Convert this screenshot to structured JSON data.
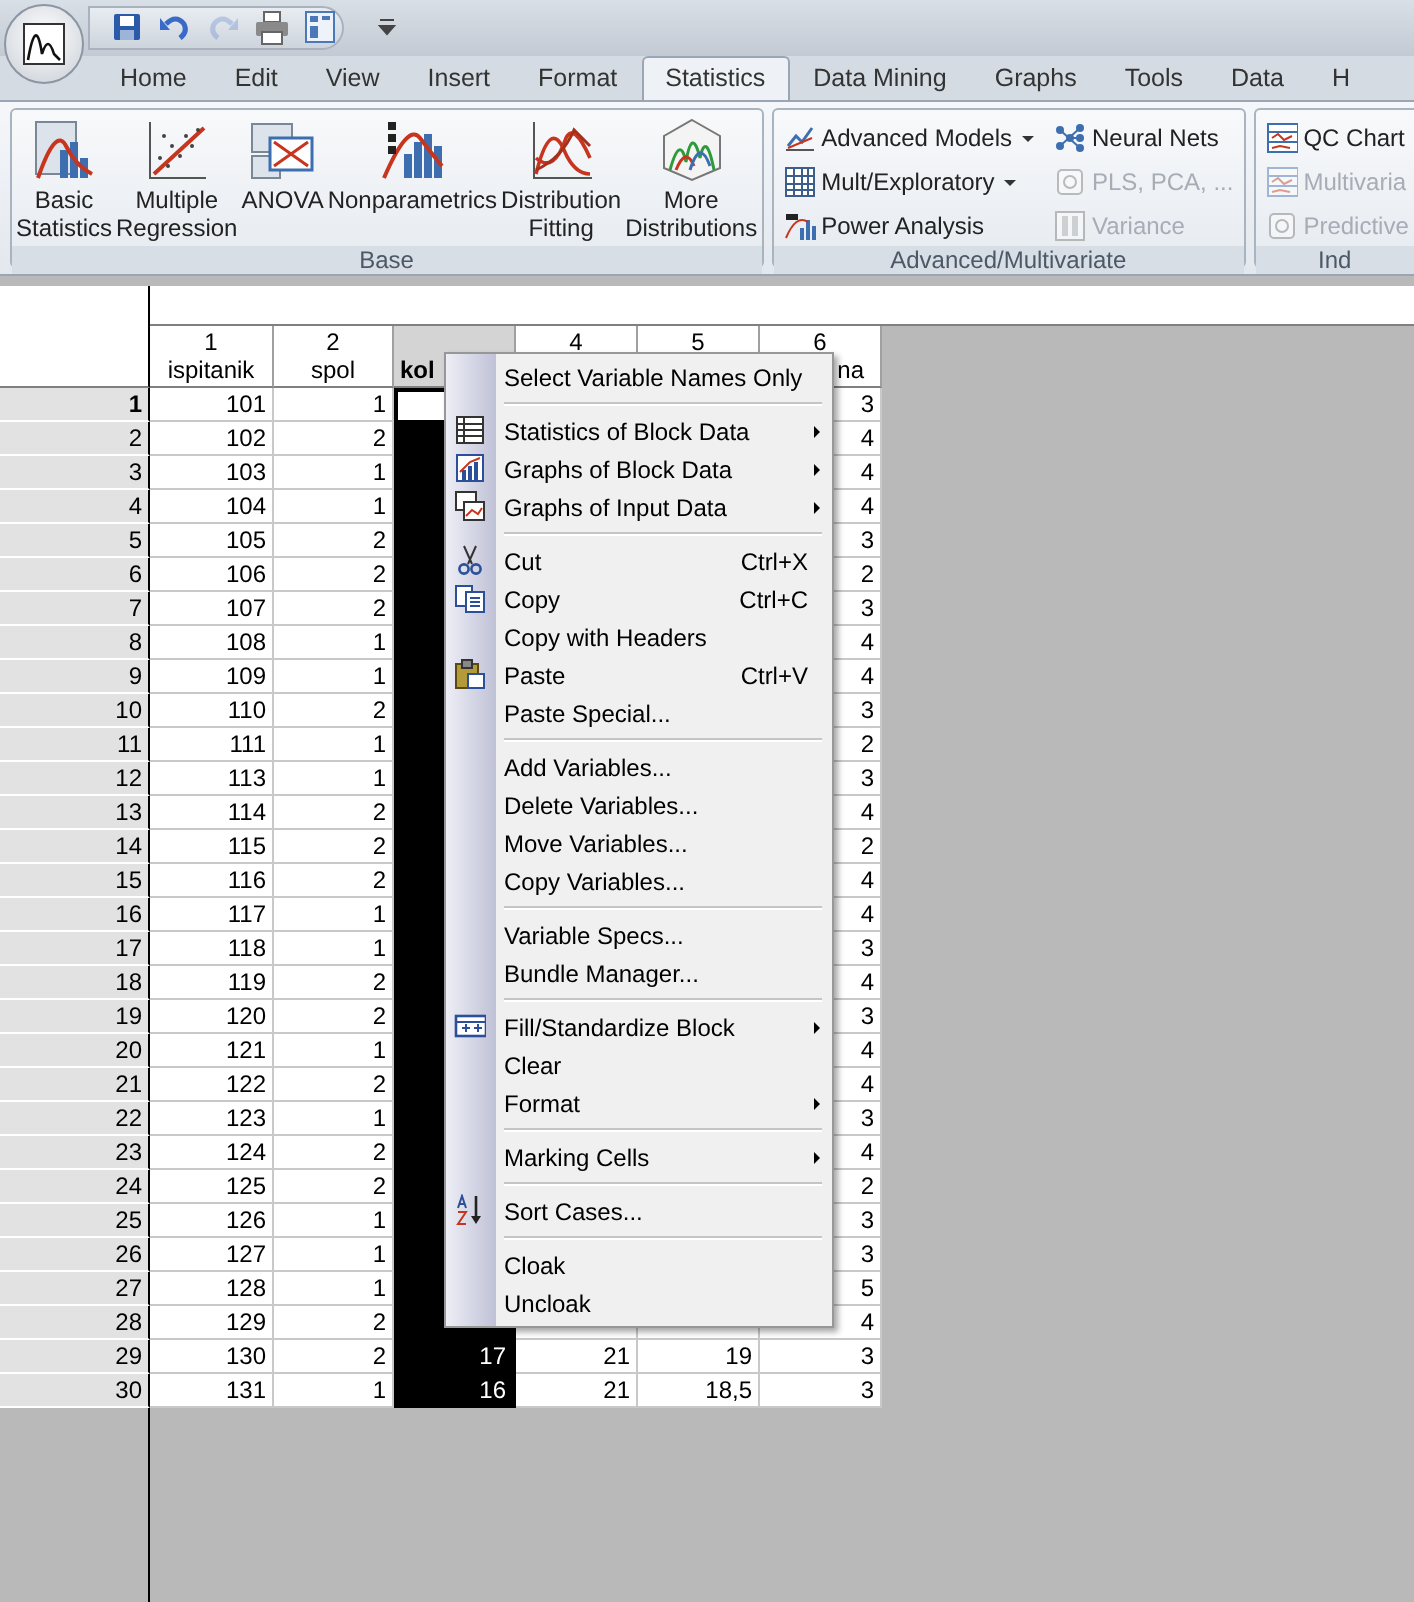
{
  "quick_access": [
    {
      "kind": "save",
      "disabled": false
    },
    {
      "kind": "undo",
      "disabled": false
    },
    {
      "kind": "redo",
      "disabled": true
    },
    {
      "kind": "print",
      "disabled": false
    },
    {
      "kind": "layout",
      "disabled": false
    },
    {
      "kind": "customize",
      "disabled": false
    }
  ],
  "tabs": [
    {
      "label": "Home",
      "selected": false
    },
    {
      "label": "Edit",
      "selected": false
    },
    {
      "label": "View",
      "selected": false
    },
    {
      "label": "Insert",
      "selected": false
    },
    {
      "label": "Format",
      "selected": false
    },
    {
      "label": "Statistics",
      "selected": true
    },
    {
      "label": "Data Mining",
      "selected": false
    },
    {
      "label": "Graphs",
      "selected": false
    },
    {
      "label": "Tools",
      "selected": false
    },
    {
      "label": "Data",
      "selected": false
    },
    {
      "label": "H",
      "selected": false
    }
  ],
  "ribbon_groups": [
    {
      "label": "Base",
      "kind": "large",
      "items": [
        {
          "label": "Basic\nStatistics"
        },
        {
          "label": "Multiple\nRegression"
        },
        {
          "label": "ANOVA"
        },
        {
          "label": "Nonparametrics"
        },
        {
          "label": "Distribution\nFitting"
        },
        {
          "label": "More\nDistributions"
        }
      ]
    },
    {
      "label": "Advanced/Multivariate",
      "kind": "small",
      "items": [
        {
          "label": "Advanced Models",
          "dropdown": true,
          "disabled": false
        },
        {
          "label": "Neural Nets",
          "dropdown": false,
          "disabled": false
        },
        {
          "label": "Mult/Exploratory",
          "dropdown": true,
          "disabled": false
        },
        {
          "label": "PLS, PCA, ...",
          "dropdown": false,
          "disabled": true
        },
        {
          "label": "Power Analysis",
          "dropdown": false,
          "disabled": false
        },
        {
          "label": "Variance",
          "dropdown": false,
          "disabled": true
        }
      ]
    },
    {
      "label": "Ind",
      "kind": "small",
      "items": [
        {
          "label": "QC Chart",
          "disabled": false
        },
        {
          "label": "Multivaria",
          "disabled": true
        },
        {
          "label": "Predictive",
          "disabled": true
        }
      ]
    }
  ],
  "grid": {
    "columns": [
      {
        "number": "1",
        "name": "ispitanik",
        "selected": false
      },
      {
        "number": "2",
        "name": "spol",
        "selected": false
      },
      {
        "name": "kol",
        "selected": true
      },
      {
        "number": "4",
        "selected": false
      },
      {
        "number": "5",
        "selected": false
      },
      {
        "number": "6",
        "name": "na",
        "selected": false
      }
    ],
    "rows": [
      {
        "label": "1",
        "current": true,
        "cells": [
          "101",
          "1",
          null,
          null,
          null,
          "3"
        ]
      },
      {
        "label": "2",
        "current": false,
        "cells": [
          "102",
          "2",
          null,
          null,
          null,
          "4"
        ]
      },
      {
        "label": "3",
        "current": false,
        "cells": [
          "103",
          "1",
          null,
          null,
          null,
          "4"
        ]
      },
      {
        "label": "4",
        "current": false,
        "cells": [
          "104",
          "1",
          null,
          null,
          null,
          "4"
        ]
      },
      {
        "label": "5",
        "current": false,
        "cells": [
          "105",
          "2",
          null,
          null,
          null,
          "3"
        ]
      },
      {
        "label": "6",
        "current": false,
        "cells": [
          "106",
          "2",
          null,
          null,
          null,
          "2"
        ]
      },
      {
        "label": "7",
        "current": false,
        "cells": [
          "107",
          "2",
          null,
          null,
          null,
          "3"
        ]
      },
      {
        "label": "8",
        "current": false,
        "cells": [
          "108",
          "1",
          null,
          null,
          null,
          "4"
        ]
      },
      {
        "label": "9",
        "current": false,
        "cells": [
          "109",
          "1",
          null,
          null,
          null,
          "4"
        ]
      },
      {
        "label": "10",
        "current": false,
        "cells": [
          "110",
          "2",
          null,
          null,
          null,
          "3"
        ]
      },
      {
        "label": "11",
        "current": false,
        "cells": [
          "111",
          "1",
          null,
          null,
          null,
          "2"
        ]
      },
      {
        "label": "12",
        "current": false,
        "cells": [
          "113",
          "1",
          null,
          null,
          null,
          "3"
        ]
      },
      {
        "label": "13",
        "current": false,
        "cells": [
          "114",
          "2",
          null,
          null,
          null,
          "4"
        ]
      },
      {
        "label": "14",
        "current": false,
        "cells": [
          "115",
          "2",
          null,
          null,
          null,
          "2"
        ]
      },
      {
        "label": "15",
        "current": false,
        "cells": [
          "116",
          "2",
          null,
          null,
          null,
          "4"
        ]
      },
      {
        "label": "16",
        "current": false,
        "cells": [
          "117",
          "1",
          null,
          null,
          null,
          "4"
        ]
      },
      {
        "label": "17",
        "current": false,
        "cells": [
          "118",
          "1",
          null,
          null,
          null,
          "3"
        ]
      },
      {
        "label": "18",
        "current": false,
        "cells": [
          "119",
          "2",
          null,
          null,
          null,
          "4"
        ]
      },
      {
        "label": "19",
        "current": false,
        "cells": [
          "120",
          "2",
          null,
          null,
          null,
          "3"
        ]
      },
      {
        "label": "20",
        "current": false,
        "cells": [
          "121",
          "1",
          null,
          null,
          null,
          "4"
        ]
      },
      {
        "label": "21",
        "current": false,
        "cells": [
          "122",
          "2",
          null,
          null,
          null,
          "4"
        ]
      },
      {
        "label": "22",
        "current": false,
        "cells": [
          "123",
          "1",
          null,
          null,
          null,
          "3"
        ]
      },
      {
        "label": "23",
        "current": false,
        "cells": [
          "124",
          "2",
          null,
          null,
          null,
          "4"
        ]
      },
      {
        "label": "24",
        "current": false,
        "cells": [
          "125",
          "2",
          null,
          null,
          null,
          "2"
        ]
      },
      {
        "label": "25",
        "current": false,
        "cells": [
          "126",
          "1",
          null,
          null,
          null,
          "3"
        ]
      },
      {
        "label": "26",
        "current": false,
        "cells": [
          "127",
          "1",
          null,
          null,
          null,
          "3"
        ]
      },
      {
        "label": "27",
        "current": false,
        "cells": [
          "128",
          "1",
          null,
          null,
          null,
          "5"
        ]
      },
      {
        "label": "28",
        "current": false,
        "cells": [
          "129",
          "2",
          null,
          null,
          null,
          "4"
        ]
      },
      {
        "label": "29",
        "current": false,
        "cells": [
          "130",
          "2",
          "17",
          "21",
          "19",
          "3"
        ]
      },
      {
        "label": "30",
        "current": false,
        "cells": [
          "131",
          "1",
          "16",
          "21",
          "18,5",
          "3"
        ]
      }
    ]
  },
  "context_menu": [
    {
      "kind": "item",
      "label": "Select Variable Names Only",
      "submenu": false
    },
    {
      "kind": "separator"
    },
    {
      "kind": "item",
      "label": "Statistics of Block Data",
      "submenu": true
    },
    {
      "kind": "item",
      "label": "Graphs of Block Data",
      "submenu": true
    },
    {
      "kind": "item",
      "label": "Graphs of Input Data",
      "submenu": true
    },
    {
      "kind": "separator"
    },
    {
      "kind": "item",
      "label": "Cut",
      "shortcut": "Ctrl+X",
      "submenu": false
    },
    {
      "kind": "item",
      "label": "Copy",
      "shortcut": "Ctrl+C",
      "submenu": false
    },
    {
      "kind": "item",
      "label": "Copy with Headers",
      "submenu": false
    },
    {
      "kind": "item",
      "label": "Paste",
      "shortcut": "Ctrl+V",
      "submenu": false
    },
    {
      "kind": "item",
      "label": "Paste Special...",
      "submenu": false
    },
    {
      "kind": "separator"
    },
    {
      "kind": "item",
      "label": "Add Variables...",
      "submenu": false
    },
    {
      "kind": "item",
      "label": "Delete Variables...",
      "submenu": false
    },
    {
      "kind": "item",
      "label": "Move Variables...",
      "submenu": false
    },
    {
      "kind": "item",
      "label": "Copy Variables...",
      "submenu": false
    },
    {
      "kind": "separator"
    },
    {
      "kind": "item",
      "label": "Variable Specs...",
      "submenu": false
    },
    {
      "kind": "item",
      "label": "Bundle Manager...",
      "submenu": false
    },
    {
      "kind": "separator"
    },
    {
      "kind": "item",
      "label": "Fill/Standardize Block",
      "submenu": true
    },
    {
      "kind": "item",
      "label": "Clear",
      "submenu": false
    },
    {
      "kind": "item",
      "label": "Format",
      "submenu": true
    },
    {
      "kind": "separator"
    },
    {
      "kind": "item",
      "label": "Marking Cells",
      "submenu": true
    },
    {
      "kind": "separator"
    },
    {
      "kind": "item",
      "label": "Sort Cases...",
      "submenu": false
    },
    {
      "kind": "separator"
    },
    {
      "kind": "item",
      "label": "Cloak",
      "submenu": false
    },
    {
      "kind": "item",
      "label": "Uncloak",
      "submenu": false
    }
  ]
}
